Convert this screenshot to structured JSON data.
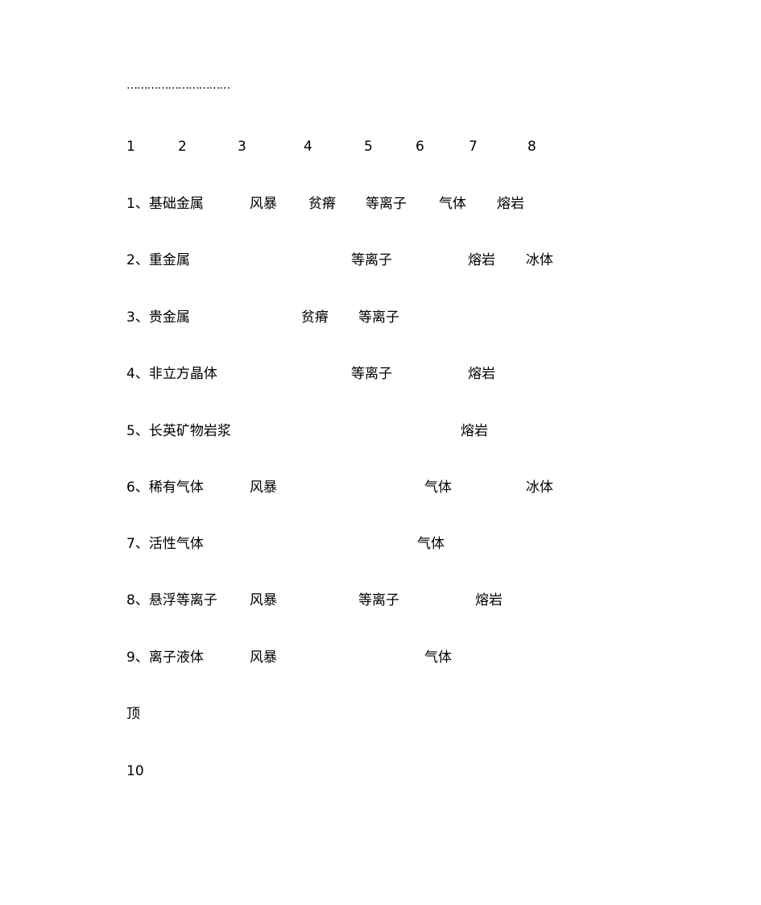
{
  "document": {
    "dotted_leader": "…………………………",
    "header_numbers": [
      "1",
      "2",
      "3",
      "4",
      "5",
      "6",
      "7",
      "8"
    ],
    "rows": [
      {
        "label": "1、基础金属",
        "cells": [
          "风暴",
          "贫瘠",
          "等离子",
          "气体",
          "熔岩"
        ]
      },
      {
        "label": "2、重金属",
        "cells": [
          "等离子",
          "熔岩",
          "冰体"
        ]
      },
      {
        "label": "3、贵金属",
        "cells": [
          "贫瘠",
          "等离子"
        ]
      },
      {
        "label": "4、非立方晶体",
        "cells": [
          "等离子",
          "熔岩"
        ]
      },
      {
        "label": "5、长英矿物岩浆",
        "cells": [
          "熔岩"
        ]
      },
      {
        "label": "6、稀有气体",
        "cells": [
          "风暴",
          "气体",
          "冰体"
        ]
      },
      {
        "label": "7、活性气体",
        "cells": [
          "气体"
        ]
      },
      {
        "label": "8、悬浮等离子",
        "cells": [
          "风暴",
          "等离子",
          "熔岩"
        ]
      },
      {
        "label": "9、离子液体",
        "cells": [
          "风暴",
          "气体"
        ]
      }
    ],
    "footer_word": "顶",
    "page_number": "10"
  }
}
